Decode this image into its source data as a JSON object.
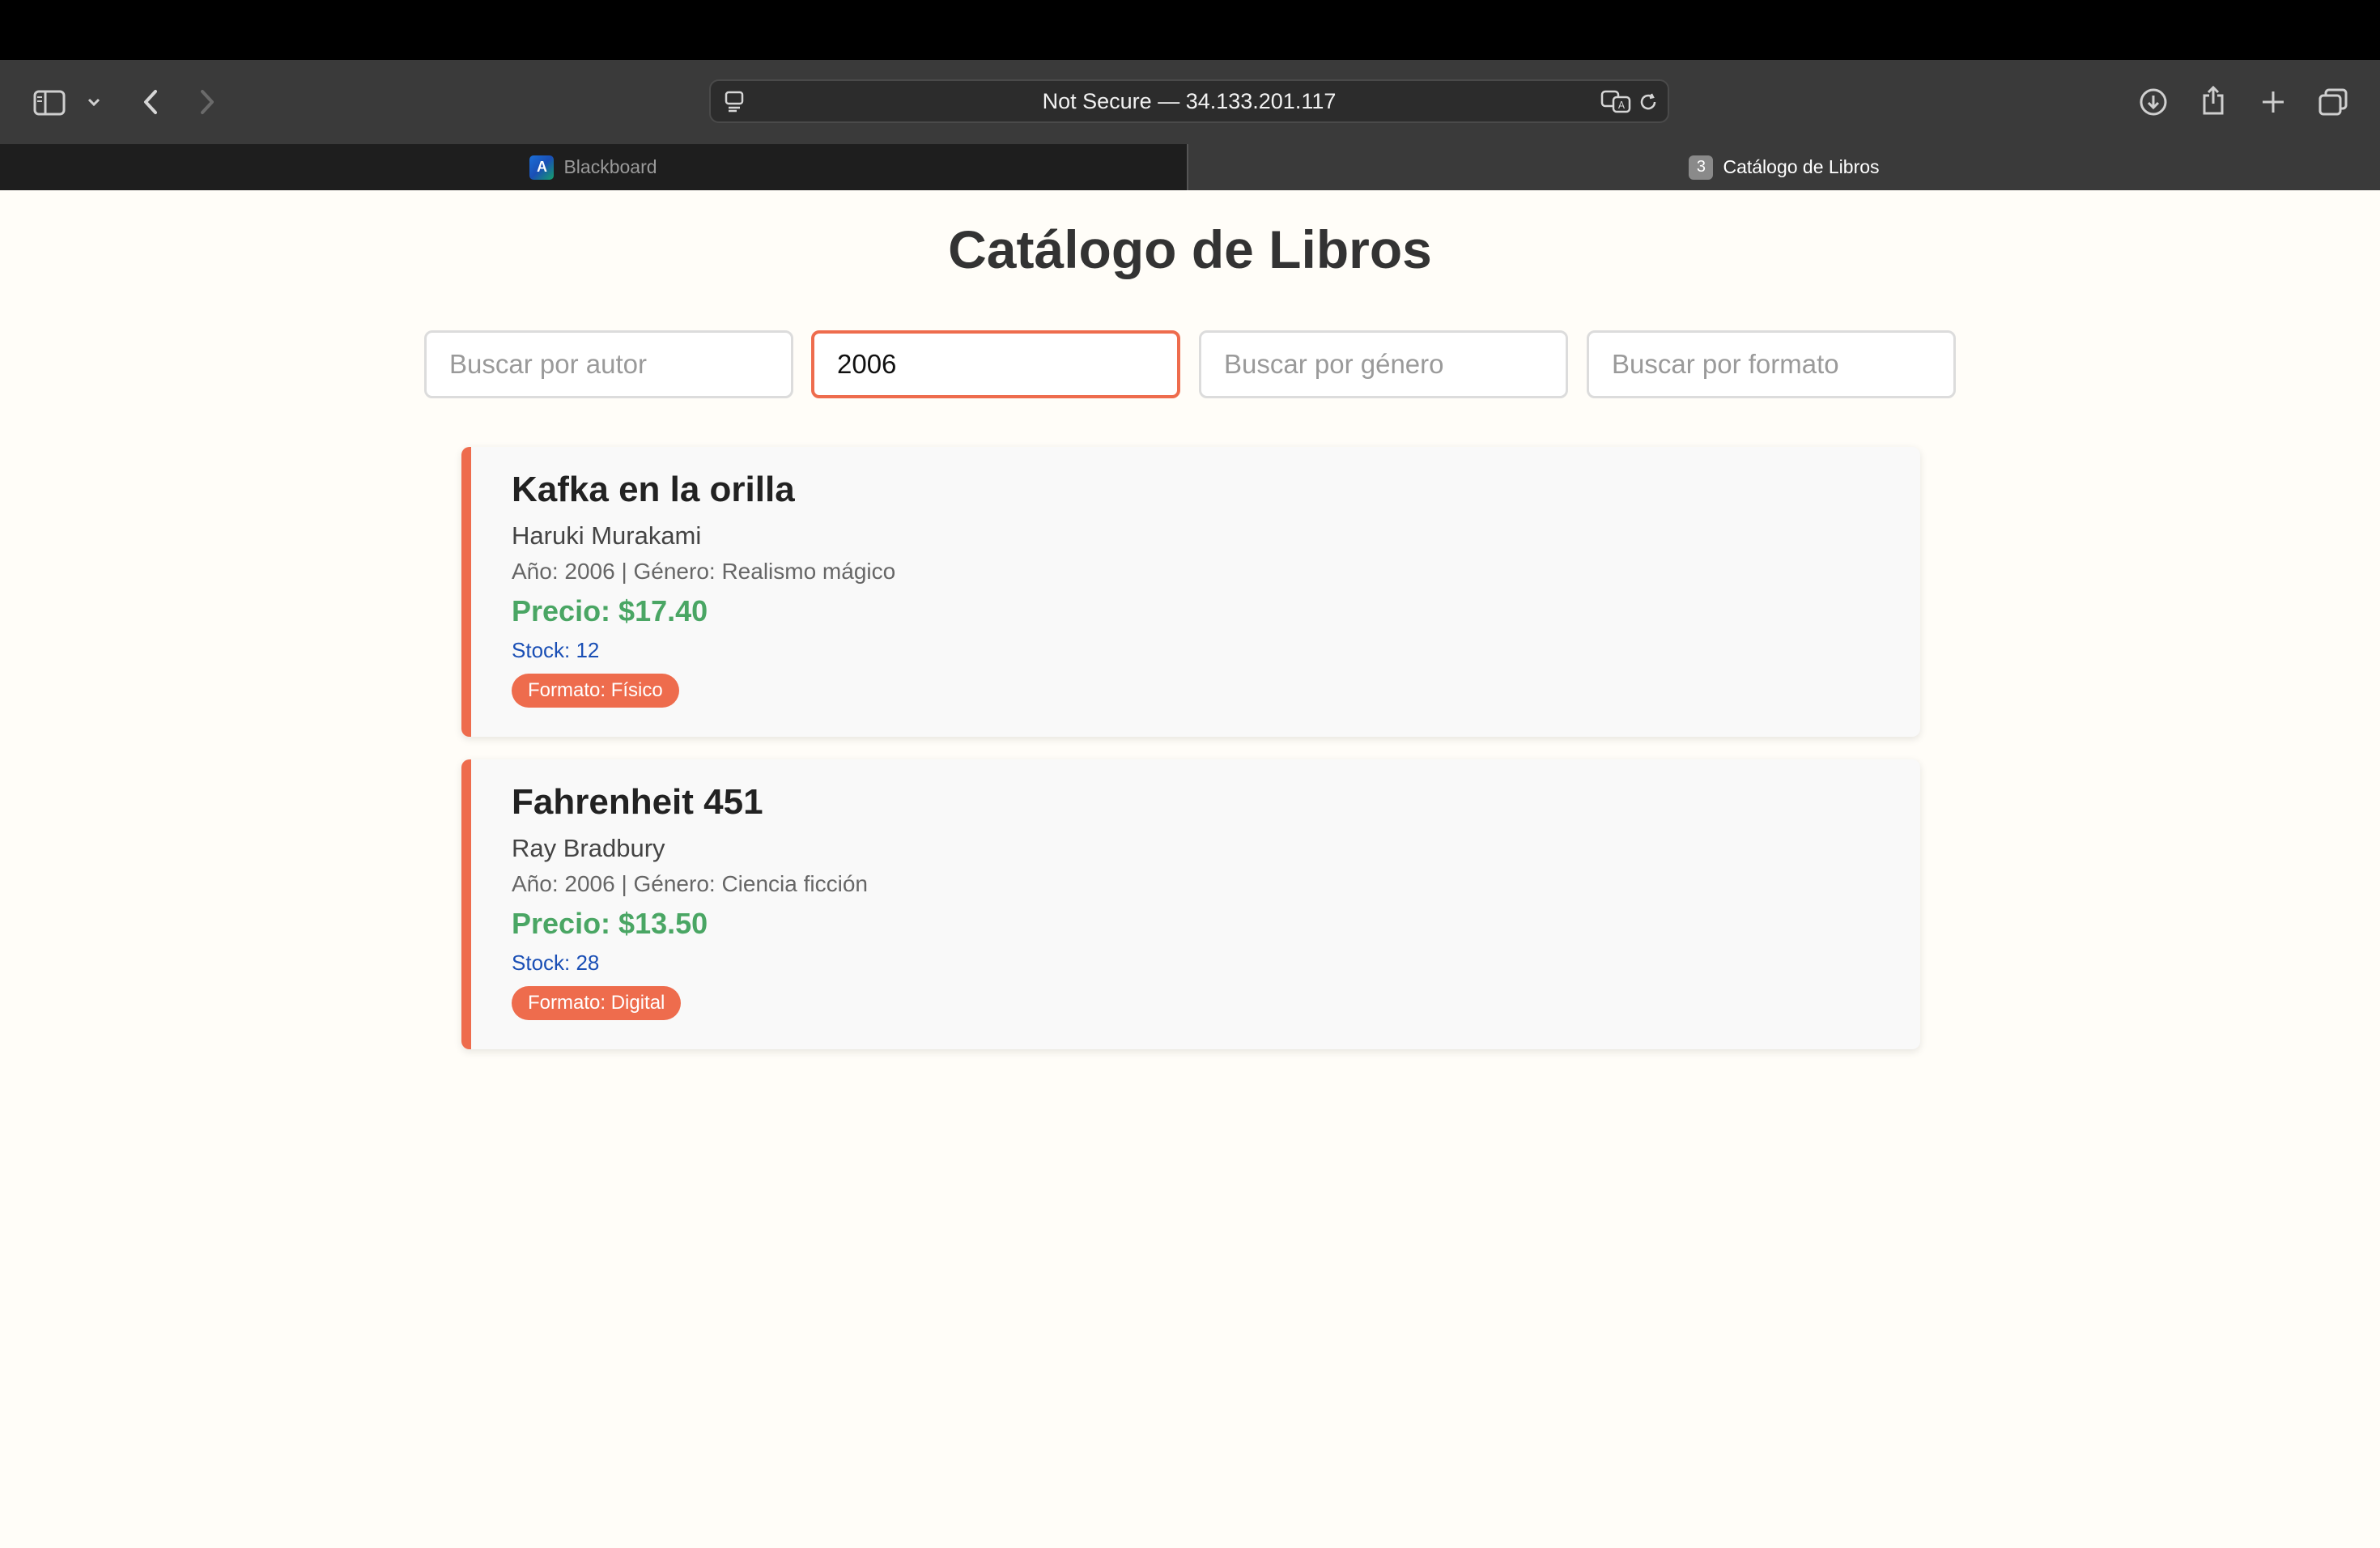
{
  "browser": {
    "address": "Not Secure — 34.133.201.117",
    "tabs": [
      {
        "label": "Blackboard",
        "favicon": "blackboard-logo",
        "favicon_text": "A",
        "active": false
      },
      {
        "label": "Catálogo de Libros",
        "favicon": "tab-number",
        "favicon_text": "3",
        "active": true
      }
    ]
  },
  "page": {
    "title": "Catálogo de Libros",
    "filters": [
      {
        "name": "author",
        "placeholder": "Buscar por autor",
        "value": ""
      },
      {
        "name": "year",
        "placeholder": "",
        "value": "2006",
        "focused": true
      },
      {
        "name": "genre",
        "placeholder": "Buscar por género",
        "value": ""
      },
      {
        "name": "format",
        "placeholder": "Buscar por formato",
        "value": ""
      }
    ],
    "books": [
      {
        "title": "Kafka en la orilla",
        "author": "Haruki Murakami",
        "meta": "Año: 2006 | Género: Realismo mágico",
        "price": "Precio: $17.40",
        "stock": "Stock: 12",
        "format": "Formato: Físico"
      },
      {
        "title": "Fahrenheit 451",
        "author": "Ray Bradbury",
        "meta": "Año: 2006 | Género: Ciencia ficción",
        "price": "Precio: $13.50",
        "stock": "Stock: 28",
        "format": "Formato: Digital"
      }
    ]
  },
  "colors": {
    "accent": "#ee6c4d",
    "price": "#4aa664",
    "stock": "#1a4fb5",
    "page_bg": "#fffdf8"
  }
}
